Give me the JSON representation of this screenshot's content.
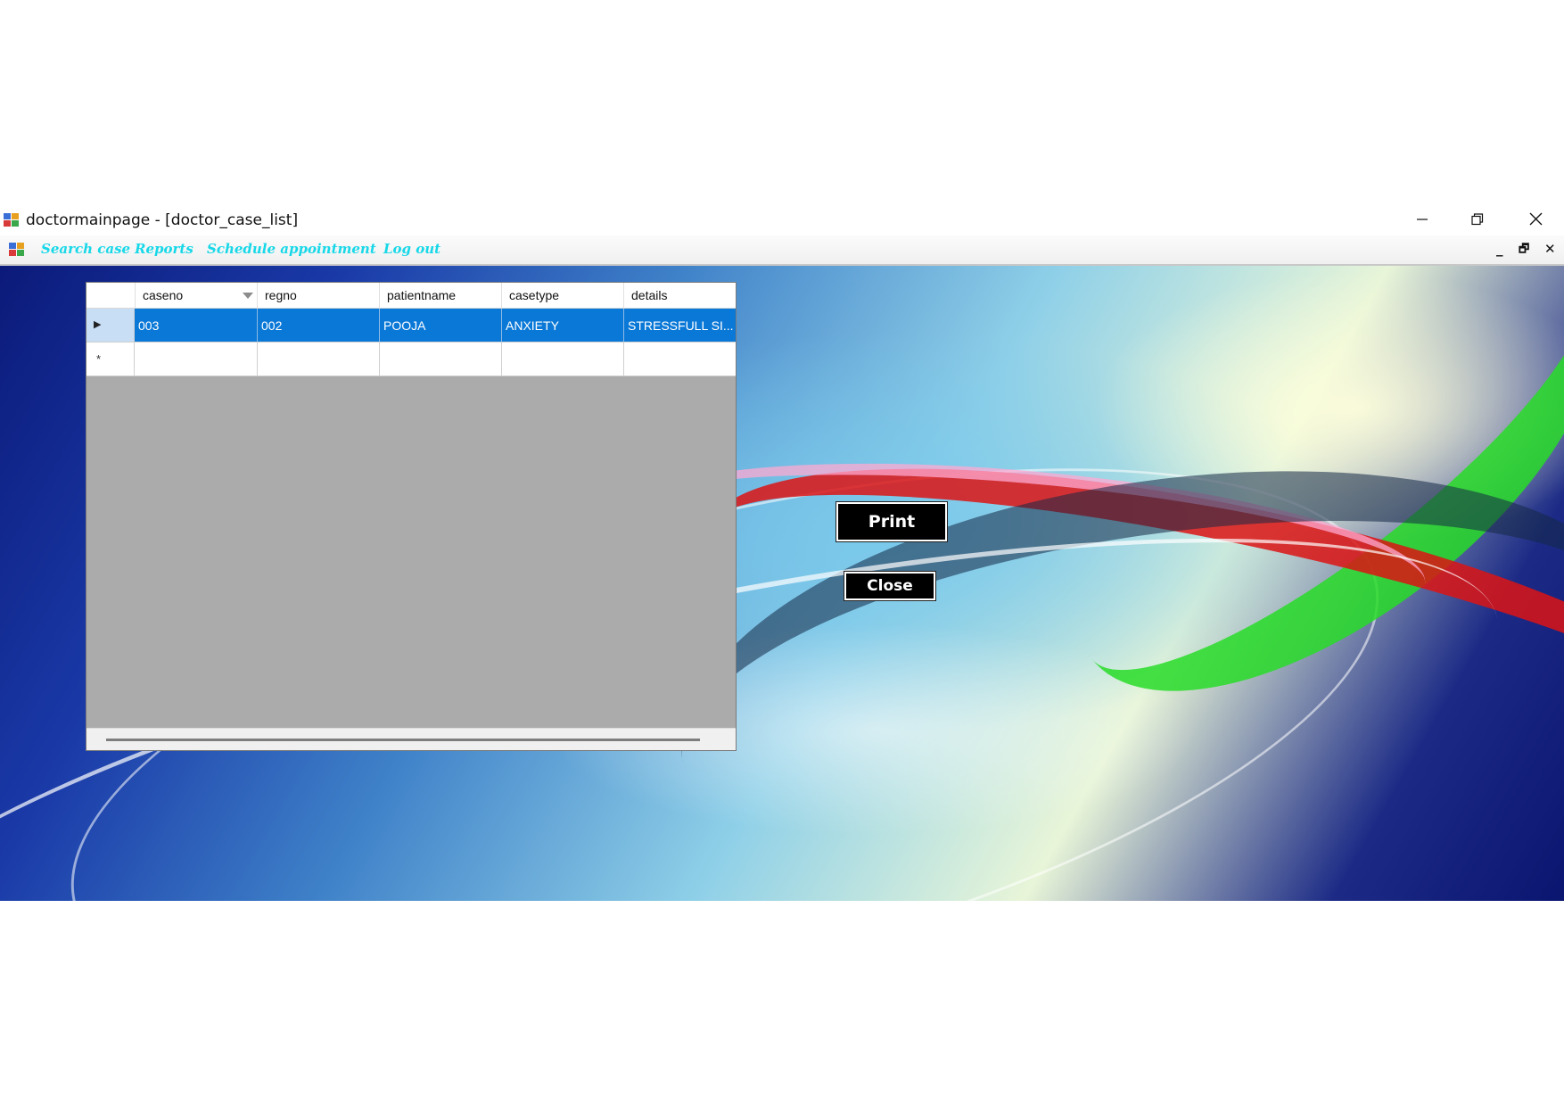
{
  "window": {
    "title": "doctormainpage - [doctor_case_list]",
    "controls": {
      "minimize_icon": "minimize-icon",
      "restore_icon": "restore-icon",
      "close_icon": "close-icon"
    }
  },
  "menubar": {
    "items": [
      "Search case",
      "Reports",
      "Schedule appointment",
      "Log out"
    ],
    "mdi_controls": [
      "_",
      "🗗",
      "✕"
    ]
  },
  "grid": {
    "columns": [
      "caseno",
      "regno",
      "patientname",
      "casetype",
      "details"
    ],
    "rows": [
      {
        "selected": true,
        "cells": [
          "003",
          "002",
          "POOJA",
          "ANXIETY",
          "STRESSFULL SI..."
        ]
      }
    ],
    "new_row_marker": "*",
    "current_row_marker": "▶"
  },
  "buttons": {
    "print": "Print",
    "close": "Close"
  },
  "colors": {
    "menu_text": "#17d8e8",
    "selection": "#0a78d7",
    "grid_background": "#ababab"
  }
}
